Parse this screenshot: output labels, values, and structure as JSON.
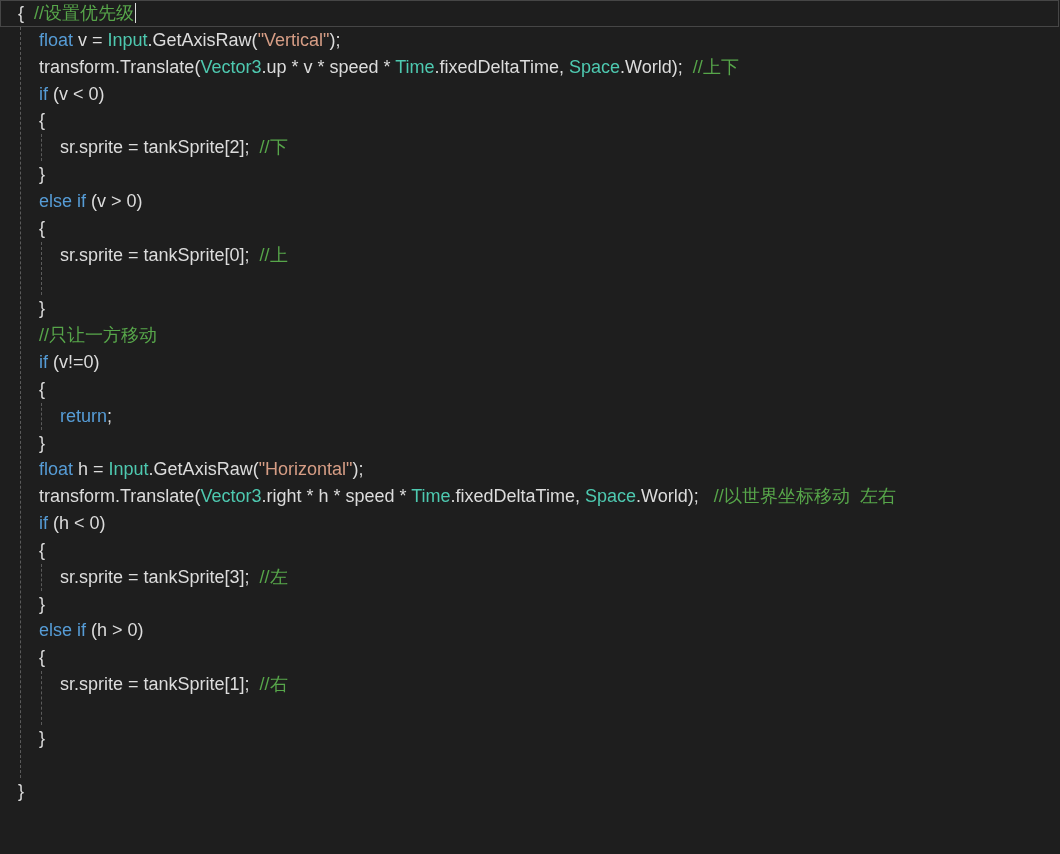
{
  "editor": {
    "lines": [
      {
        "kind": "code",
        "current_line": true,
        "tokens": [
          {
            "kind": "txt",
            "text": "{  "
          },
          {
            "kind": "cmt",
            "text": "//设置优先级"
          }
        ],
        "children": [
          {
            "kind": "code",
            "tokens": [
              {
                "kind": "kw",
                "text": "float"
              },
              {
                "kind": "txt",
                "text": " v = "
              },
              {
                "kind": "type",
                "text": "Input"
              },
              {
                "kind": "txt",
                "text": ".GetAxisRaw("
              },
              {
                "kind": "str",
                "text": "\"Vertical\""
              },
              {
                "kind": "txt",
                "text": ");"
              }
            ]
          },
          {
            "kind": "code",
            "tokens": [
              {
                "kind": "txt",
                "text": "transform.Translate("
              },
              {
                "kind": "type",
                "text": "Vector3"
              },
              {
                "kind": "txt",
                "text": ".up * v * speed * "
              },
              {
                "kind": "type",
                "text": "Time"
              },
              {
                "kind": "txt",
                "text": ".fixedDeltaTime, "
              },
              {
                "kind": "type",
                "text": "Space"
              },
              {
                "kind": "txt",
                "text": ".World);  "
              },
              {
                "kind": "cmt",
                "text": "//上下"
              }
            ]
          },
          {
            "kind": "code",
            "tokens": [
              {
                "kind": "kw",
                "text": "if"
              },
              {
                "kind": "txt",
                "text": " (v < 0)"
              }
            ]
          },
          {
            "kind": "code",
            "tokens": [
              {
                "kind": "txt",
                "text": "{"
              }
            ],
            "children": [
              {
                "kind": "code",
                "tokens": [
                  {
                    "kind": "txt",
                    "text": "sr.sprite = tankSprite[2];  "
                  },
                  {
                    "kind": "cmt",
                    "text": "//下"
                  }
                ]
              }
            ]
          },
          {
            "kind": "code",
            "tokens": [
              {
                "kind": "txt",
                "text": "}"
              }
            ]
          },
          {
            "kind": "code",
            "tokens": [
              {
                "kind": "kw",
                "text": "else if"
              },
              {
                "kind": "txt",
                "text": " (v > 0)"
              }
            ]
          },
          {
            "kind": "code",
            "tokens": [
              {
                "kind": "txt",
                "text": "{"
              }
            ],
            "children": [
              {
                "kind": "code",
                "tokens": [
                  {
                    "kind": "txt",
                    "text": "sr.sprite = tankSprite[0];  "
                  },
                  {
                    "kind": "cmt",
                    "text": "//上"
                  }
                ]
              },
              {
                "kind": "blank"
              }
            ]
          },
          {
            "kind": "code",
            "tokens": [
              {
                "kind": "txt",
                "text": "}"
              }
            ]
          },
          {
            "kind": "code",
            "tokens": [
              {
                "kind": "cmt",
                "text": "//只让一方移动"
              }
            ]
          },
          {
            "kind": "code",
            "tokens": [
              {
                "kind": "kw",
                "text": "if"
              },
              {
                "kind": "txt",
                "text": " (v!=0)"
              }
            ]
          },
          {
            "kind": "code",
            "tokens": [
              {
                "kind": "txt",
                "text": "{"
              }
            ],
            "children": [
              {
                "kind": "code",
                "tokens": [
                  {
                    "kind": "kw",
                    "text": "return"
                  },
                  {
                    "kind": "txt",
                    "text": ";"
                  }
                ]
              }
            ]
          },
          {
            "kind": "code",
            "tokens": [
              {
                "kind": "txt",
                "text": "}"
              }
            ]
          },
          {
            "kind": "code",
            "tokens": [
              {
                "kind": "kw",
                "text": "float"
              },
              {
                "kind": "txt",
                "text": " h = "
              },
              {
                "kind": "type",
                "text": "Input"
              },
              {
                "kind": "txt",
                "text": ".GetAxisRaw("
              },
              {
                "kind": "str",
                "text": "\"Horizontal\""
              },
              {
                "kind": "txt",
                "text": ");"
              }
            ]
          },
          {
            "kind": "code",
            "tokens": [
              {
                "kind": "txt",
                "text": "transform.Translate("
              },
              {
                "kind": "type",
                "text": "Vector3"
              },
              {
                "kind": "txt",
                "text": ".right * h * speed * "
              },
              {
                "kind": "type",
                "text": "Time"
              },
              {
                "kind": "txt",
                "text": ".fixedDeltaTime, "
              },
              {
                "kind": "type",
                "text": "Space"
              },
              {
                "kind": "txt",
                "text": ".World);   "
              },
              {
                "kind": "cmt",
                "text": "//以世界坐标移动  左右"
              }
            ]
          },
          {
            "kind": "code",
            "tokens": [
              {
                "kind": "kw",
                "text": "if"
              },
              {
                "kind": "txt",
                "text": " (h < 0)"
              }
            ]
          },
          {
            "kind": "code",
            "tokens": [
              {
                "kind": "txt",
                "text": "{"
              }
            ],
            "children": [
              {
                "kind": "code",
                "tokens": [
                  {
                    "kind": "txt",
                    "text": "sr.sprite = tankSprite[3];  "
                  },
                  {
                    "kind": "cmt",
                    "text": "//左"
                  }
                ]
              }
            ]
          },
          {
            "kind": "code",
            "tokens": [
              {
                "kind": "txt",
                "text": "}"
              }
            ]
          },
          {
            "kind": "code",
            "tokens": [
              {
                "kind": "kw",
                "text": "else if"
              },
              {
                "kind": "txt",
                "text": " (h > 0)"
              }
            ]
          },
          {
            "kind": "code",
            "tokens": [
              {
                "kind": "txt",
                "text": "{"
              }
            ],
            "children": [
              {
                "kind": "code",
                "tokens": [
                  {
                    "kind": "txt",
                    "text": "sr.sprite = tankSprite[1];  "
                  },
                  {
                    "kind": "cmt",
                    "text": "//右"
                  }
                ]
              },
              {
                "kind": "blank"
              }
            ]
          },
          {
            "kind": "code",
            "tokens": [
              {
                "kind": "txt",
                "text": "}"
              }
            ]
          },
          {
            "kind": "blank"
          }
        ]
      },
      {
        "kind": "code",
        "tokens": [
          {
            "kind": "txt",
            "text": "}"
          }
        ]
      }
    ]
  }
}
